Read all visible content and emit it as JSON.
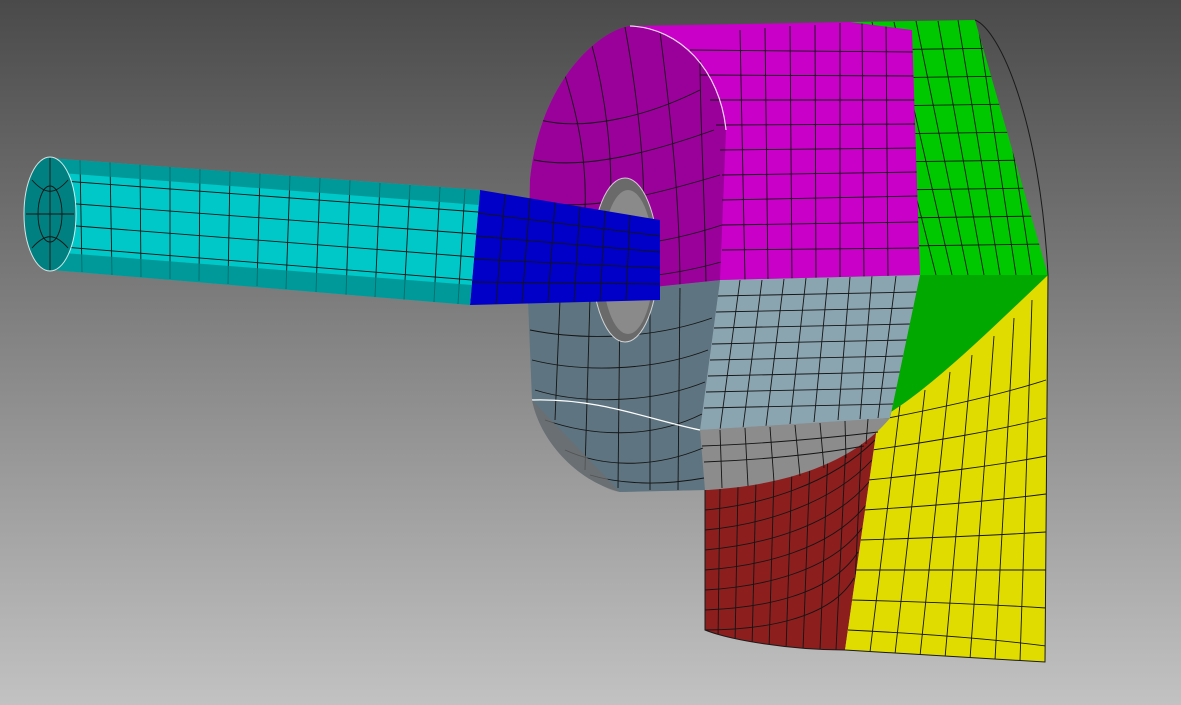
{
  "scene": {
    "kind": "3d-fe-mesh-view",
    "background": {
      "top": "#4a4a4a",
      "bottom": "#c2c2c2"
    },
    "parts": [
      {
        "id": "shaft",
        "color": "#00c8c8",
        "shade": "#008080"
      },
      {
        "id": "taper",
        "color": "#0000c8",
        "shade": "#000070"
      },
      {
        "id": "disc-upper",
        "color": "#c800c8",
        "shade": "#800080"
      },
      {
        "id": "disc-lower",
        "color": "#8aa4b0",
        "shade": "#3e5058"
      },
      {
        "id": "disc-bottom",
        "color": "#8c8c8c",
        "shade": "#5a5a5a"
      },
      {
        "id": "volute-green",
        "color": "#00c800",
        "shade": "#00a000"
      },
      {
        "id": "outlet-yellow",
        "color": "#e0dc00",
        "shade": "#bcb800"
      },
      {
        "id": "outlet-red",
        "color": "#8c1e1e",
        "shade": "#5a1010"
      }
    ]
  }
}
